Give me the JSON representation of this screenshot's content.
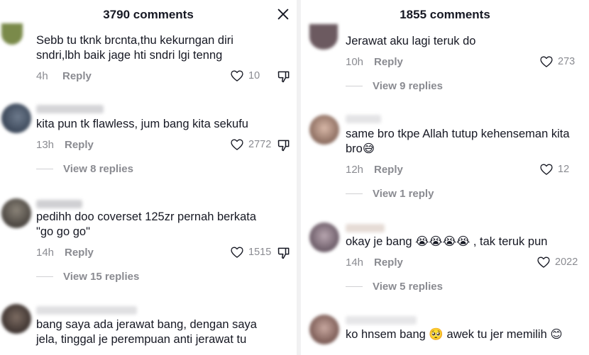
{
  "left": {
    "title": "3790 comments",
    "comments": [
      {
        "text": "Sebb tu tknk brcnta,thu kekurngan diri\nsndri,lbh baik jage hti sndri lgi tenng",
        "time": "4h",
        "reply": "Reply",
        "likes": "10"
      },
      {
        "text": "kita pun tk flawless, jum bang kita sekufu",
        "time": "13h",
        "reply": "Reply",
        "likes": "2772",
        "view_replies": "View 8 replies"
      },
      {
        "text": "pedihh doo coverset 125zr pernah berkata\n\"go go go\"",
        "time": "14h",
        "reply": "Reply",
        "likes": "1515",
        "view_replies": "View 15 replies"
      },
      {
        "text": "bang saya ada jerawat bang, dengan saya\njela, tinggal je perempuan anti jerawat tu"
      }
    ]
  },
  "right": {
    "title": "1855 comments",
    "comments": [
      {
        "text": "Jerawat aku lagi teruk do",
        "time": "10h",
        "reply": "Reply",
        "likes": "273",
        "view_replies": "View 9 replies"
      },
      {
        "text": "same bro tkpe Allah tutup kehenseman kita\nbro😅",
        "time": "12h",
        "reply": "Reply",
        "likes": "12",
        "view_replies": "View 1 reply"
      },
      {
        "text": "okay je bang 😭😭😭😭 , tak teruk pun",
        "time": "14h",
        "reply": "Reply",
        "likes": "2022",
        "view_replies": "View 5 replies"
      },
      {
        "text": "ko hnsem bang 🥺 awek tu jer memilih 😊"
      }
    ]
  },
  "icons": {
    "close": "close-icon",
    "like": "heart-outline-icon",
    "dislike": "thumbs-down-icon"
  },
  "colors": {
    "text": "#161823",
    "muted": "#8a8b91"
  }
}
